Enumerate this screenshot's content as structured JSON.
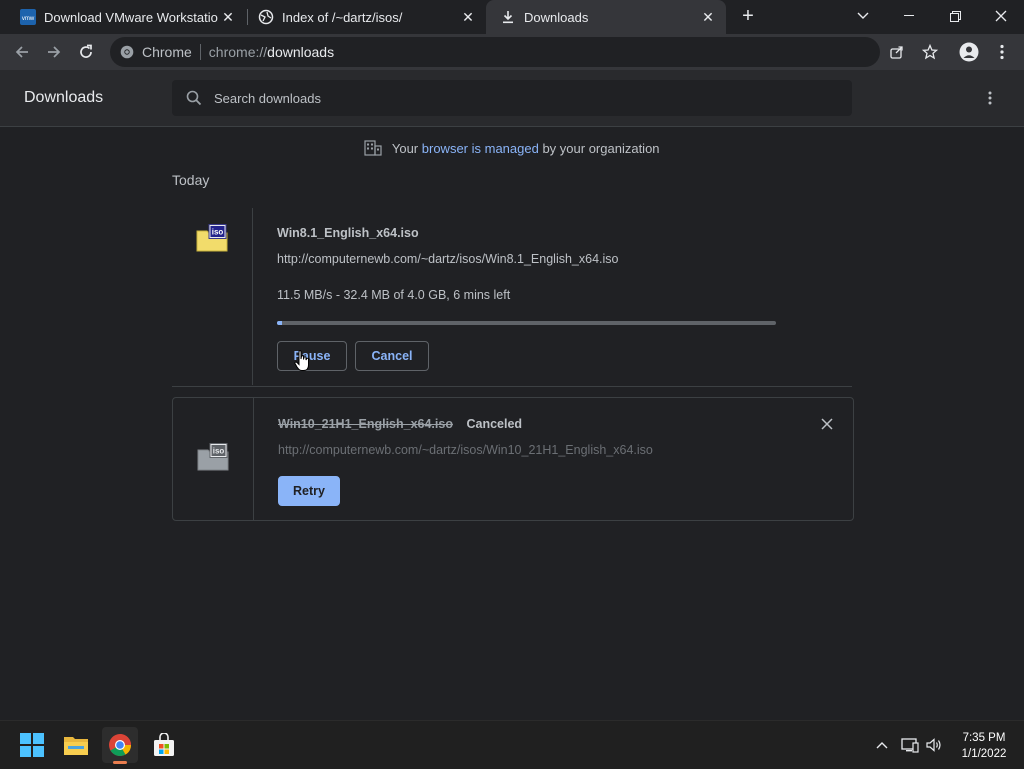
{
  "tabs": [
    {
      "title": "Download VMware Workstation Player",
      "active": false
    },
    {
      "title": "Index of /~dartz/isos/",
      "active": false
    },
    {
      "title": "Downloads",
      "active": true
    }
  ],
  "toolbar": {
    "omnibox_scheme": "Chrome",
    "omnibox_url_prefix": "chrome://",
    "omnibox_url_path": "downloads"
  },
  "downloads_page": {
    "title": "Downloads",
    "search_placeholder": "Search downloads",
    "managed_prefix": "Your",
    "managed_link": "browser is managed",
    "managed_suffix": "by your organization",
    "date_heading": "Today"
  },
  "items": [
    {
      "file_name": "Win8.1_English_x64.iso",
      "url": "http://computernewb.com/~dartz/isos/Win8.1_English_x64.iso",
      "status": "11.5 MB/s - 32.4 MB of 4.0 GB, 6 mins left",
      "progress_percent": 1,
      "icon_label": "iso",
      "buttons": {
        "pause": "Pause",
        "cancel": "Cancel"
      }
    },
    {
      "file_name": "Win10_21H1_English_x64.iso",
      "tag": "Canceled",
      "url": "http://computernewb.com/~dartz/isos/Win10_21H1_English_x64.iso",
      "icon_label": "iso",
      "buttons": {
        "retry": "Retry"
      }
    }
  ],
  "taskbar": {
    "time": "7:35 PM",
    "date": "1/1/2022"
  },
  "colors": {
    "accent": "#8ab4f8",
    "background": "#202124",
    "header": "#292a2d"
  }
}
